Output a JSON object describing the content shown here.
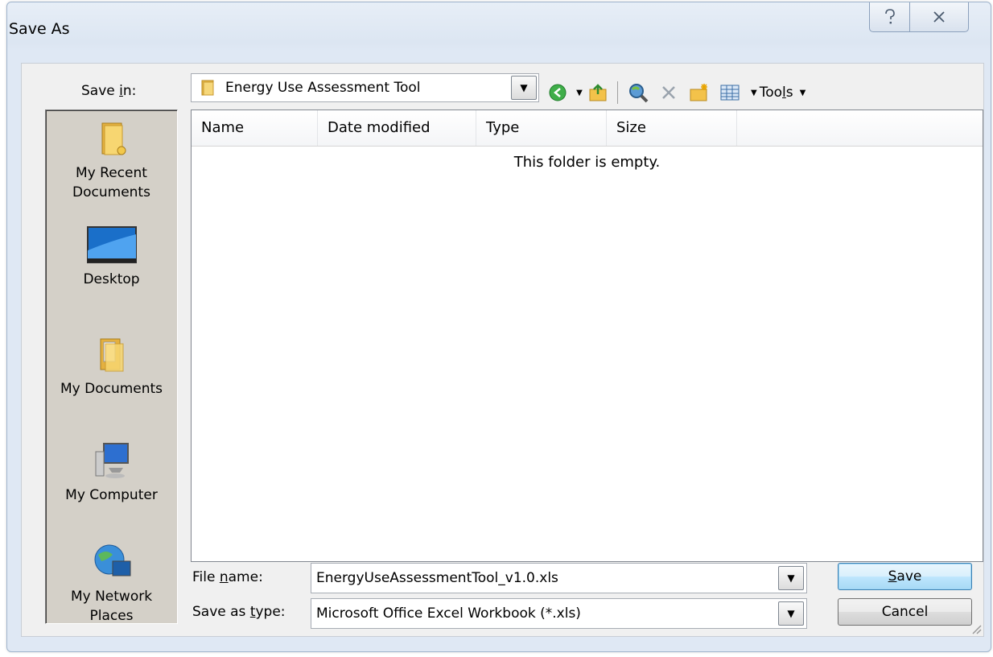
{
  "window": {
    "title": "Save As",
    "help_icon": "?",
    "close_icon": "✕"
  },
  "toolbar": {
    "save_in_label": "Save in:",
    "save_in_value": "Energy Use Assessment Tool",
    "tools_label": "Tools"
  },
  "places": [
    {
      "label": "My Recent\nDocuments",
      "icon": "recent-folder-icon"
    },
    {
      "label": "Desktop",
      "icon": "desktop-icon"
    },
    {
      "label": "My Documents",
      "icon": "documents-folder-icon"
    },
    {
      "label": "My Computer",
      "icon": "computer-icon"
    },
    {
      "label": "My Network\nPlaces",
      "icon": "network-icon"
    }
  ],
  "list": {
    "columns": [
      "Name",
      "Date modified",
      "Type",
      "Size"
    ],
    "empty_message": "This folder is empty."
  },
  "footer": {
    "file_name_label": "File name:",
    "file_name_value": "EnergyUseAssessmentTool_v1.0.xls",
    "save_type_label": "Save as type:",
    "save_type_value": "Microsoft Office Excel Workbook (*.xls)",
    "save_button": "Save",
    "cancel_button": "Cancel"
  }
}
